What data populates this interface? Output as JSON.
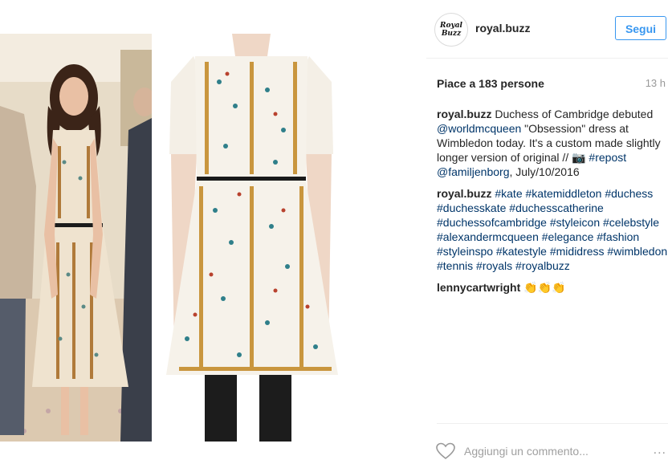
{
  "post": {
    "username": "royal.buzz",
    "avatar_text_line1": "Royal",
    "avatar_text_line2": "Buzz",
    "follow_label": "Segui",
    "likes": "Piace a 183 persone",
    "time": "13 h"
  },
  "caption": {
    "user": "royal.buzz",
    "t1": " Duchess of Cambridge debuted ",
    "mention1": "@worldmcqueen",
    "t2": " \"Obsession\" dress at Wimbledon today. It's a custom made slightly longer version of original // ",
    "camera_icon": "📷",
    "t3": " ",
    "hashtag": "#repost",
    "t4": " ",
    "mention2": "@familjenborg",
    "t5": ", July/10/2016"
  },
  "hashtags_comment": {
    "user": "royal.buzz",
    "tags": "#kate #katemiddleton #duchess #duchesskate #duchesscatherine #duchessofcambridge #styleicon #celebstyle #alexandermcqueen #elegance #fashion #styleinspo #katestyle #mididress #wimbledon #tennis #royals #royalbuzz"
  },
  "comment2": {
    "user": "lennycartwright",
    "text": "👏👏👏"
  },
  "footer": {
    "add_comment_placeholder": "Aggiungi un commento...",
    "more_label": "..."
  },
  "colors": {
    "link": "#003569",
    "follow": "#3897f0"
  }
}
